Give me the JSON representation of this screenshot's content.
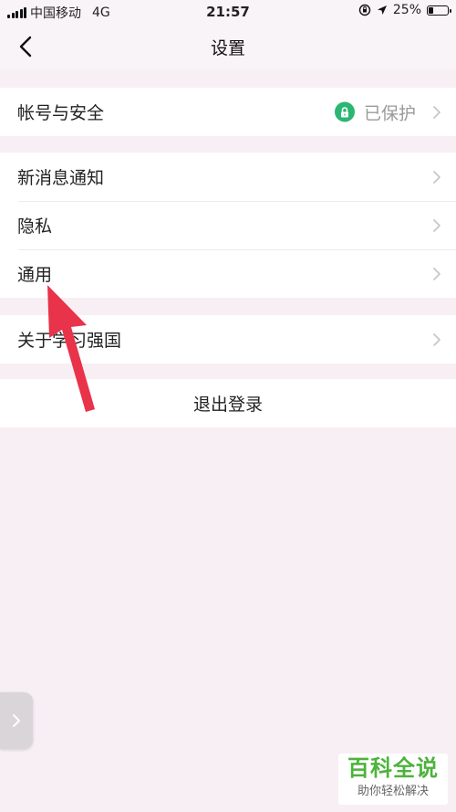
{
  "status_bar": {
    "carrier": "中国移动",
    "network": "4G",
    "time": "21:57",
    "battery_percent": "25%",
    "battery_level": 0.25,
    "icons": [
      "signal-icon",
      "orientation-lock-icon",
      "location-icon",
      "battery-icon"
    ]
  },
  "nav": {
    "title": "设置",
    "back_icon": "back-chevron-icon"
  },
  "groups": [
    {
      "rows": [
        {
          "label": "帐号与安全",
          "status": "已保护",
          "status_icon": "lock-icon"
        }
      ]
    },
    {
      "rows": [
        {
          "label": "新消息通知"
        },
        {
          "label": "隐私"
        },
        {
          "label": "通用"
        }
      ]
    },
    {
      "rows": [
        {
          "label": "关于学习强国"
        }
      ]
    }
  ],
  "logout": {
    "label": "退出登录"
  },
  "annotation": {
    "arrow_color": "#e8334a",
    "points_to": "通用"
  },
  "watermark": {
    "title": "百科全说",
    "subtitle": "助你轻松解决"
  },
  "colors": {
    "background": "#f7eff4",
    "accent_green": "#2bb673",
    "watermark_green": "#4cb33b",
    "chevron": "#c7c7cc"
  }
}
